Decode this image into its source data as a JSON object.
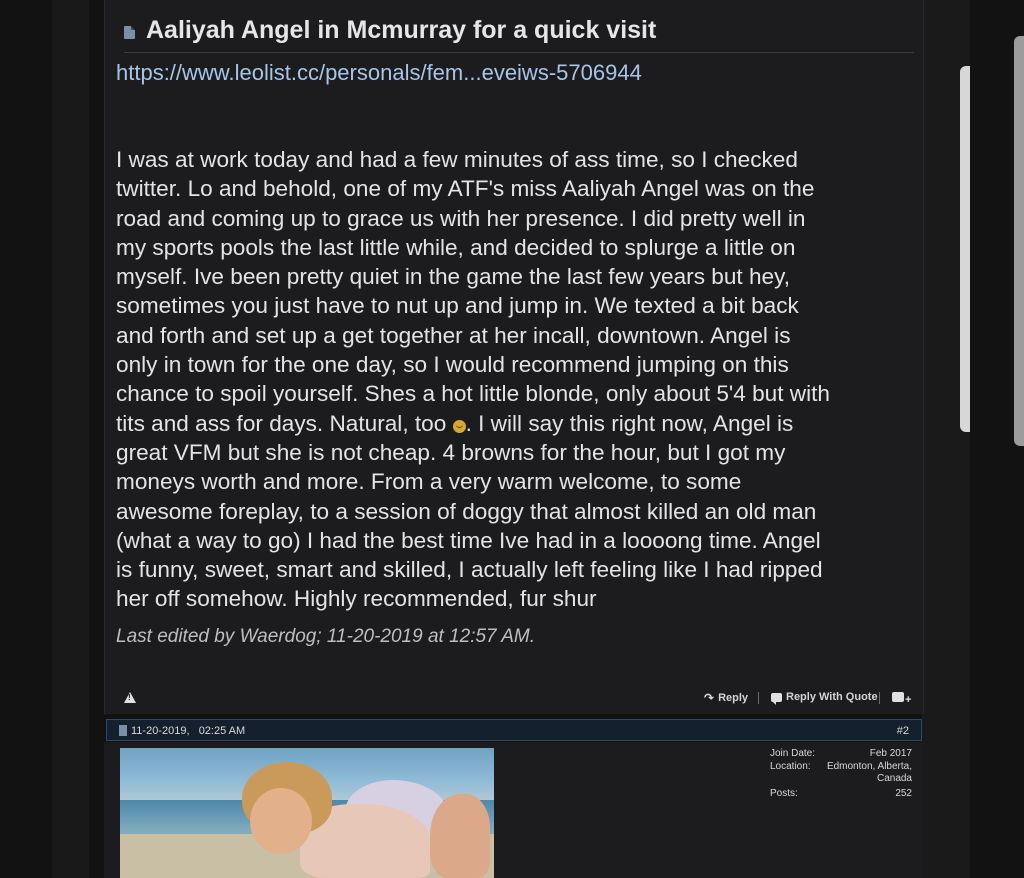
{
  "thread": {
    "title": "Aaliyah Angel in Mcmurray for a quick visit",
    "link": "https://www.leolist.cc/personals/fem...eveiws-5706944",
    "body_before_emoji": "I was at work today and had a few minutes of ass time, so I checked\ntwitter. Lo and behold, one of my ATF's miss Aaliyah Angel was on the\nroad and coming up to grace us with her presence. I did pretty well in\nmy sports pools the last little while, and decided to splurge a little on\nmyself. Ive been pretty quiet in the game the last few years but hey,\nsometimes you just have to nut up and jump in. We texted a bit back\nand forth and set up a get together at her incall, downtown. Angel is\nonly in town for the one day, so I would recommend jumping on this\nchance to spoil yourself. Shes a hot little blonde, only about 5'4 but with\ntits and ass for days. Natural, too ",
    "body_after_emoji": ". I will say this right now, Angel is\ngreat VFM but she is not cheap. 4 browns for the hour, but I got my\nmoneys worth and more. From a very warm welcome, to some\nawesome foreplay, to a session of doggy that almost killed an old man\n(what a way to go) I had the best time Ive had in a loooong time. Angel\nis funny, sweet, smart and skilled, I actually left feeling like I had ripped\nher off somehow. Highly recommended, fur shur",
    "edited": "Last edited by Waerdog; 11-20-2019 at 12:57 AM.",
    "emoji_icon": "smiley-icon"
  },
  "footer": {
    "reply": "Reply",
    "reply_quote": "Reply With Quote",
    "report_icon": "warning-icon",
    "multiquote_icon": "multiquote-icon"
  },
  "post2": {
    "date": "11-20-2019,",
    "time": "02:25 AM",
    "number": "#2",
    "join_label": "Join Date:",
    "join_value": "Feb 2017",
    "location_label": "Location:",
    "location_value": "Edmonton, Alberta, Canada",
    "posts_label": "Posts:",
    "posts_value": "252"
  },
  "colors": {
    "background": "#1c1c1e",
    "link": "#a8c4e6",
    "post_header": "#14202d"
  }
}
